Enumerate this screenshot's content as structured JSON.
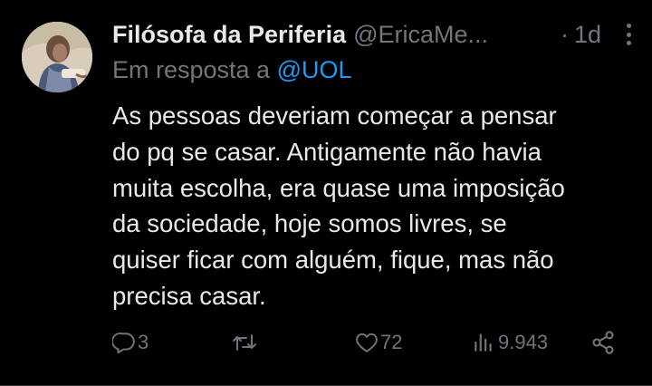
{
  "author": {
    "display_name": "Filósofa da Periferia",
    "handle": "@EricaMe...",
    "separator": "·",
    "time": "1d"
  },
  "reply_context": {
    "prefix": "Em resposta a",
    "mention": "@UOL"
  },
  "tweet_lines": [
    "As pessoas deveriam começar a pensar",
    "do pq se casar. Antigamente não havia",
    "muita escolha, era quase uma imposição",
    "da sociedade, hoje somos livres, se",
    "quiser ficar com alguém, fique, mas não",
    "precisa casar."
  ],
  "actions": {
    "reply": {
      "icon": "reply-icon",
      "count": "3"
    },
    "retweet": {
      "icon": "retweet-icon",
      "count": ""
    },
    "like": {
      "icon": "heart-icon",
      "count": "72"
    },
    "views": {
      "icon": "views-icon",
      "count": "9.943"
    },
    "share": {
      "icon": "share-icon"
    }
  },
  "colors": {
    "background": "#000000",
    "text_primary": "#e7e9ea",
    "text_secondary": "#71767b",
    "accent": "#1d9bf0"
  }
}
